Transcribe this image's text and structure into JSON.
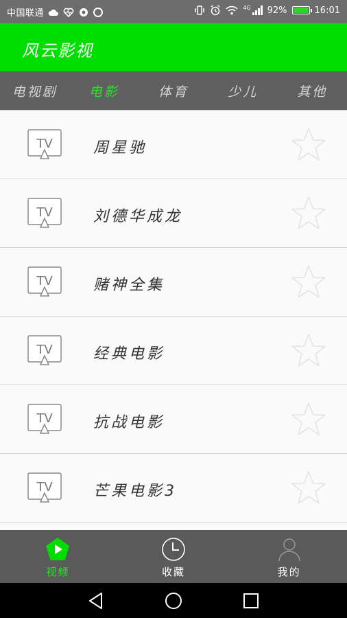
{
  "status_bar": {
    "carrier": "中国联通",
    "battery": "92%",
    "time": "16:01",
    "network": "4G",
    "icons": [
      "cloud-icon",
      "heart-rate-icon",
      "message-icon",
      "chat-icon",
      "vibrate-icon",
      "alarm-icon",
      "wifi-icon",
      "signal-icon",
      "battery-icon"
    ]
  },
  "app": {
    "title": "风云影视",
    "accent_color": "#00dd00"
  },
  "tabs": [
    {
      "label": "电视剧",
      "active": false
    },
    {
      "label": "电影",
      "active": true
    },
    {
      "label": "体育",
      "active": false
    },
    {
      "label": "少儿",
      "active": false
    },
    {
      "label": "其他",
      "active": false
    }
  ],
  "list": {
    "icon_text": "TV",
    "items": [
      {
        "label": "周星驰"
      },
      {
        "label": "刘德华成龙"
      },
      {
        "label": "赌神全集"
      },
      {
        "label": "经典电影"
      },
      {
        "label": "抗战电影"
      },
      {
        "label": "芒果电影3"
      }
    ]
  },
  "bottom_nav": [
    {
      "label": "视频",
      "icon": "play-icon",
      "active": true
    },
    {
      "label": "收藏",
      "icon": "clock-icon",
      "active": false
    },
    {
      "label": "我的",
      "icon": "user-icon",
      "active": false
    }
  ],
  "system_nav": [
    "back-icon",
    "home-icon",
    "recents-icon"
  ]
}
